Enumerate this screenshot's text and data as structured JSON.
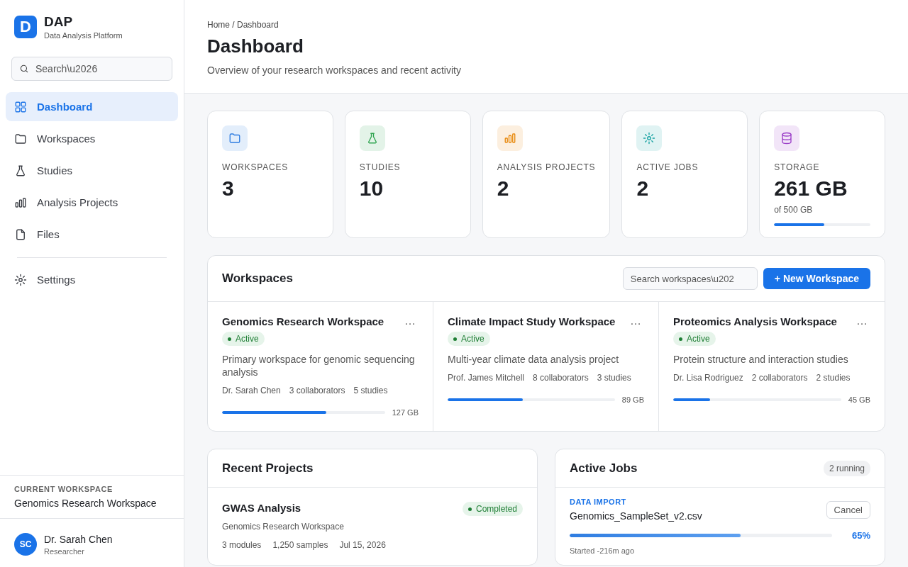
{
  "brand": {
    "logo": "D",
    "name": "DAP",
    "subtitle": "Data Analysis Platform"
  },
  "search": {
    "placeholder": "Search\\u2026"
  },
  "nav": [
    {
      "kind": "grid",
      "label": "Dashboard",
      "selected": true
    },
    {
      "kind": "folder",
      "label": "Workspaces",
      "selected": false
    },
    {
      "kind": "flask",
      "label": "Studies",
      "selected": false
    },
    {
      "kind": "chart",
      "label": "Analysis Projects",
      "selected": false
    },
    {
      "kind": "file",
      "label": "Files",
      "selected": false
    }
  ],
  "nav_bottom": [
    {
      "kind": "gear",
      "label": "Settings",
      "selected": false
    }
  ],
  "current_workspace": {
    "label": "CURRENT WORKSPACE",
    "name": "Genomics Research Workspace"
  },
  "user": {
    "initials": "SC",
    "name": "Dr. Sarah Chen",
    "role": "Researcher"
  },
  "breadcrumb": "Home / Dashboard",
  "title": "Dashboard",
  "subtitle": "Overview of your research workspaces and recent activity",
  "stats": [
    {
      "kind": "folder",
      "color": "#2f7de1",
      "label": "WORKSPACES",
      "value": "3"
    },
    {
      "kind": "flask",
      "color": "#2ea44f",
      "label": "STUDIES",
      "value": "10"
    },
    {
      "kind": "chart",
      "color": "#e8890c",
      "label": "ANALYSIS PROJECTS",
      "value": "2"
    },
    {
      "kind": "sun",
      "color": "#17a2a2",
      "label": "ACTIVE JOBS",
      "value": "2"
    },
    {
      "kind": "database",
      "color": "#9b3fc8",
      "label": "STORAGE",
      "value": "261 GB",
      "note": "of 500 GB",
      "level": 0.52
    }
  ],
  "workspaces": {
    "title": "Workspaces",
    "search_placeholder": "Search workspaces\\u202",
    "new_button": "+ New Workspace",
    "more": "…",
    "items": [
      {
        "name": "Genomics Research Workspace",
        "status": "Active",
        "description": "Primary workspace for genomic sequencing analysis",
        "owner": "Dr. Sarah Chen",
        "collaborators": "3 collaborators",
        "studies": "5 studies",
        "level": 0.64,
        "size": "127 GB"
      },
      {
        "name": "Climate Impact Study Workspace",
        "status": "Active",
        "description": "Multi-year climate data analysis project",
        "owner": "Prof. James Mitchell",
        "collaborators": "8 collaborators",
        "studies": "3 studies",
        "level": 0.45,
        "size": "89 GB"
      },
      {
        "name": "Proteomics Analysis Workspace",
        "status": "Active",
        "description": "Protein structure and interaction studies",
        "owner": "Dr. Lisa Rodriguez",
        "collaborators": "2 collaborators",
        "studies": "2 studies",
        "level": 0.22,
        "size": "45 GB"
      }
    ]
  },
  "recent_projects": {
    "title": "Recent Projects",
    "items": [
      {
        "name": "GWAS Analysis",
        "status": "Completed",
        "workspace": "Genomics Research Workspace",
        "modules": "3 modules",
        "samples": "1,250 samples",
        "date": "Jul 15, 2026"
      }
    ]
  },
  "active_jobs": {
    "title": "Active Jobs",
    "badge": "2 running",
    "items": [
      {
        "type": "DATA IMPORT",
        "file": "Genomics_SampleSet_v2.csv",
        "cancel": "Cancel",
        "level": 0.65,
        "percent": "65%",
        "started": "Started -216m ago"
      }
    ]
  }
}
